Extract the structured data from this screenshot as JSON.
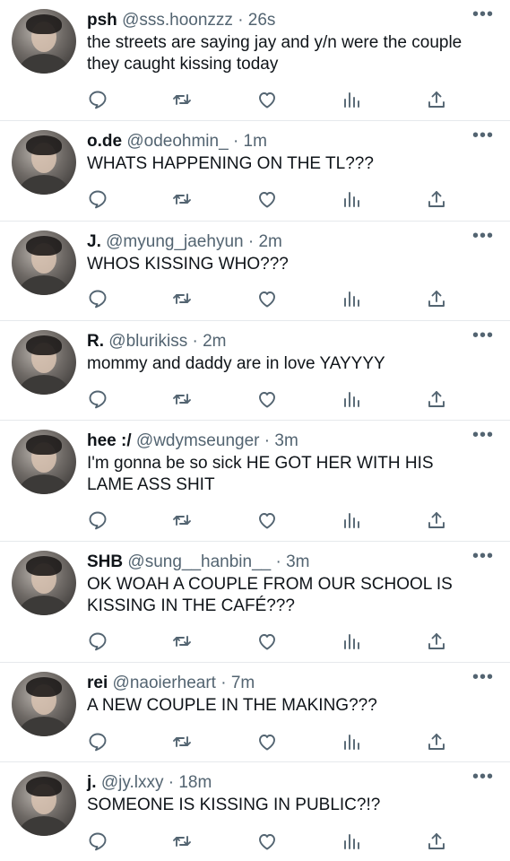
{
  "tweets": [
    {
      "name": "psh",
      "handle": "@sss.hoonzzz",
      "time": "26s",
      "text": "the streets are saying jay and y/n were the couple they caught kissing today"
    },
    {
      "name": "o.de",
      "handle": "@odeohmin_",
      "time": "1m",
      "text": "WHATS HAPPENING ON THE TL???"
    },
    {
      "name": "J.",
      "handle": "@myung_jaehyun",
      "time": "2m",
      "text": "WHOS KISSING WHO???"
    },
    {
      "name": "R.",
      "handle": "@blurikiss",
      "time": "2m",
      "text": "mommy and daddy are in love YAYYYY"
    },
    {
      "name": "hee :/",
      "handle": "@wdymseunger",
      "time": "3m",
      "text": "I'm gonna be so sick HE GOT HER WITH HIS LAME ASS SHIT"
    },
    {
      "name": "SHB",
      "handle": "@sung__hanbin__",
      "time": "3m",
      "text": "OK WOAH A COUPLE FROM OUR SCHOOL IS KISSING IN THE CAFÉ???"
    },
    {
      "name": "rei",
      "handle": "@naoierheart",
      "time": "7m",
      "text": "A NEW COUPLE IN THE MAKING???"
    },
    {
      "name": "j.",
      "handle": "@jy.lxxy",
      "time": "18m",
      "text": "SOMEONE IS KISSING IN PUBLIC?!?"
    }
  ],
  "ui": {
    "separator": "·",
    "more_glyph": "•••"
  },
  "icons": [
    "reply-icon",
    "retweet-icon",
    "like-icon",
    "views-icon",
    "share-icon"
  ],
  "colors": {
    "text": "#0f1419",
    "secondary": "#536471",
    "divider": "#e6e9ec"
  }
}
